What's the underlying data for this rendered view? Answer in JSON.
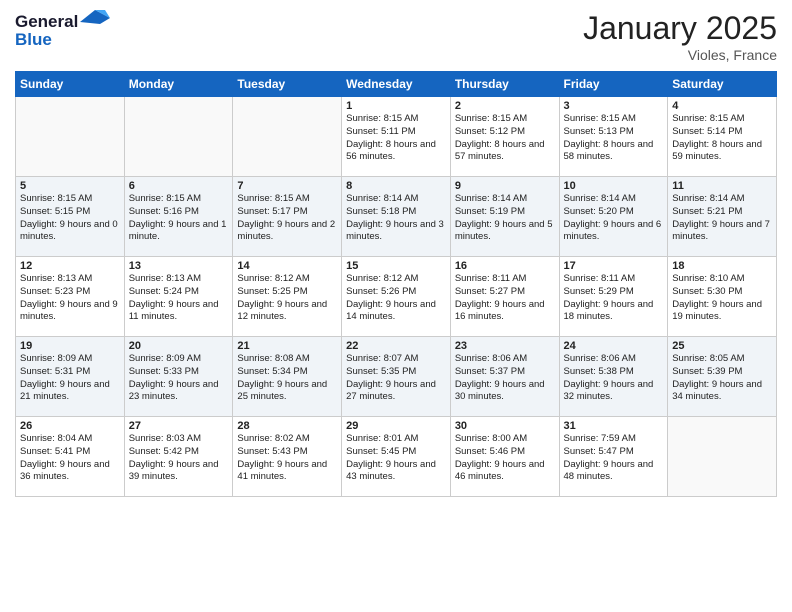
{
  "logo": {
    "text_general": "General",
    "text_blue": "Blue"
  },
  "header": {
    "month": "January 2025",
    "location": "Violes, France"
  },
  "weekdays": [
    "Sunday",
    "Monday",
    "Tuesday",
    "Wednesday",
    "Thursday",
    "Friday",
    "Saturday"
  ],
  "weeks": [
    [
      {
        "day": "",
        "sunrise": "",
        "sunset": "",
        "daylight": ""
      },
      {
        "day": "",
        "sunrise": "",
        "sunset": "",
        "daylight": ""
      },
      {
        "day": "",
        "sunrise": "",
        "sunset": "",
        "daylight": ""
      },
      {
        "day": "1",
        "sunrise": "8:15 AM",
        "sunset": "5:11 PM",
        "daylight": "8 hours and 56 minutes."
      },
      {
        "day": "2",
        "sunrise": "8:15 AM",
        "sunset": "5:12 PM",
        "daylight": "8 hours and 57 minutes."
      },
      {
        "day": "3",
        "sunrise": "8:15 AM",
        "sunset": "5:13 PM",
        "daylight": "8 hours and 58 minutes."
      },
      {
        "day": "4",
        "sunrise": "8:15 AM",
        "sunset": "5:14 PM",
        "daylight": "8 hours and 59 minutes."
      }
    ],
    [
      {
        "day": "5",
        "sunrise": "8:15 AM",
        "sunset": "5:15 PM",
        "daylight": "9 hours and 0 minutes."
      },
      {
        "day": "6",
        "sunrise": "8:15 AM",
        "sunset": "5:16 PM",
        "daylight": "9 hours and 1 minute."
      },
      {
        "day": "7",
        "sunrise": "8:15 AM",
        "sunset": "5:17 PM",
        "daylight": "9 hours and 2 minutes."
      },
      {
        "day": "8",
        "sunrise": "8:14 AM",
        "sunset": "5:18 PM",
        "daylight": "9 hours and 3 minutes."
      },
      {
        "day": "9",
        "sunrise": "8:14 AM",
        "sunset": "5:19 PM",
        "daylight": "9 hours and 5 minutes."
      },
      {
        "day": "10",
        "sunrise": "8:14 AM",
        "sunset": "5:20 PM",
        "daylight": "9 hours and 6 minutes."
      },
      {
        "day": "11",
        "sunrise": "8:14 AM",
        "sunset": "5:21 PM",
        "daylight": "9 hours and 7 minutes."
      }
    ],
    [
      {
        "day": "12",
        "sunrise": "8:13 AM",
        "sunset": "5:23 PM",
        "daylight": "9 hours and 9 minutes."
      },
      {
        "day": "13",
        "sunrise": "8:13 AM",
        "sunset": "5:24 PM",
        "daylight": "9 hours and 11 minutes."
      },
      {
        "day": "14",
        "sunrise": "8:12 AM",
        "sunset": "5:25 PM",
        "daylight": "9 hours and 12 minutes."
      },
      {
        "day": "15",
        "sunrise": "8:12 AM",
        "sunset": "5:26 PM",
        "daylight": "9 hours and 14 minutes."
      },
      {
        "day": "16",
        "sunrise": "8:11 AM",
        "sunset": "5:27 PM",
        "daylight": "9 hours and 16 minutes."
      },
      {
        "day": "17",
        "sunrise": "8:11 AM",
        "sunset": "5:29 PM",
        "daylight": "9 hours and 18 minutes."
      },
      {
        "day": "18",
        "sunrise": "8:10 AM",
        "sunset": "5:30 PM",
        "daylight": "9 hours and 19 minutes."
      }
    ],
    [
      {
        "day": "19",
        "sunrise": "8:09 AM",
        "sunset": "5:31 PM",
        "daylight": "9 hours and 21 minutes."
      },
      {
        "day": "20",
        "sunrise": "8:09 AM",
        "sunset": "5:33 PM",
        "daylight": "9 hours and 23 minutes."
      },
      {
        "day": "21",
        "sunrise": "8:08 AM",
        "sunset": "5:34 PM",
        "daylight": "9 hours and 25 minutes."
      },
      {
        "day": "22",
        "sunrise": "8:07 AM",
        "sunset": "5:35 PM",
        "daylight": "9 hours and 27 minutes."
      },
      {
        "day": "23",
        "sunrise": "8:06 AM",
        "sunset": "5:37 PM",
        "daylight": "9 hours and 30 minutes."
      },
      {
        "day": "24",
        "sunrise": "8:06 AM",
        "sunset": "5:38 PM",
        "daylight": "9 hours and 32 minutes."
      },
      {
        "day": "25",
        "sunrise": "8:05 AM",
        "sunset": "5:39 PM",
        "daylight": "9 hours and 34 minutes."
      }
    ],
    [
      {
        "day": "26",
        "sunrise": "8:04 AM",
        "sunset": "5:41 PM",
        "daylight": "9 hours and 36 minutes."
      },
      {
        "day": "27",
        "sunrise": "8:03 AM",
        "sunset": "5:42 PM",
        "daylight": "9 hours and 39 minutes."
      },
      {
        "day": "28",
        "sunrise": "8:02 AM",
        "sunset": "5:43 PM",
        "daylight": "9 hours and 41 minutes."
      },
      {
        "day": "29",
        "sunrise": "8:01 AM",
        "sunset": "5:45 PM",
        "daylight": "9 hours and 43 minutes."
      },
      {
        "day": "30",
        "sunrise": "8:00 AM",
        "sunset": "5:46 PM",
        "daylight": "9 hours and 46 minutes."
      },
      {
        "day": "31",
        "sunrise": "7:59 AM",
        "sunset": "5:47 PM",
        "daylight": "9 hours and 48 minutes."
      },
      {
        "day": "",
        "sunrise": "",
        "sunset": "",
        "daylight": ""
      }
    ]
  ]
}
